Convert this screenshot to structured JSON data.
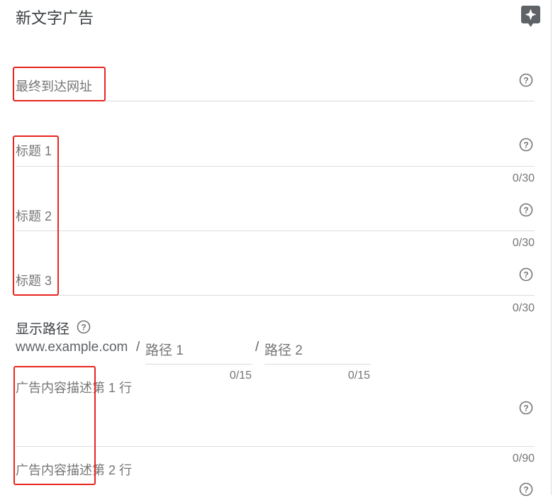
{
  "header": {
    "title": "新文字广告",
    "ai_icon": "sparkle-icon"
  },
  "fields": {
    "final_url": {
      "label": "最终到达网址"
    },
    "headline_1": {
      "label": "标题 1",
      "counter": "0/30"
    },
    "headline_2": {
      "label": "标题 2",
      "counter": "0/30"
    },
    "headline_3": {
      "label": "标题 3",
      "counter": "0/30"
    },
    "description_1": {
      "label": "广告内容描述第 1 行",
      "counter": "0/90"
    },
    "description_2": {
      "label": "广告内容描述第 2 行"
    }
  },
  "display_path": {
    "label": "显示路径",
    "domain": "www.example.com",
    "sep1": "/",
    "path1_placeholder": "路径 1",
    "path1_counter": "0/15",
    "sep2": "/",
    "path2_placeholder": "路径 2",
    "path2_counter": "0/15"
  },
  "highlight_color": "#e8261e"
}
